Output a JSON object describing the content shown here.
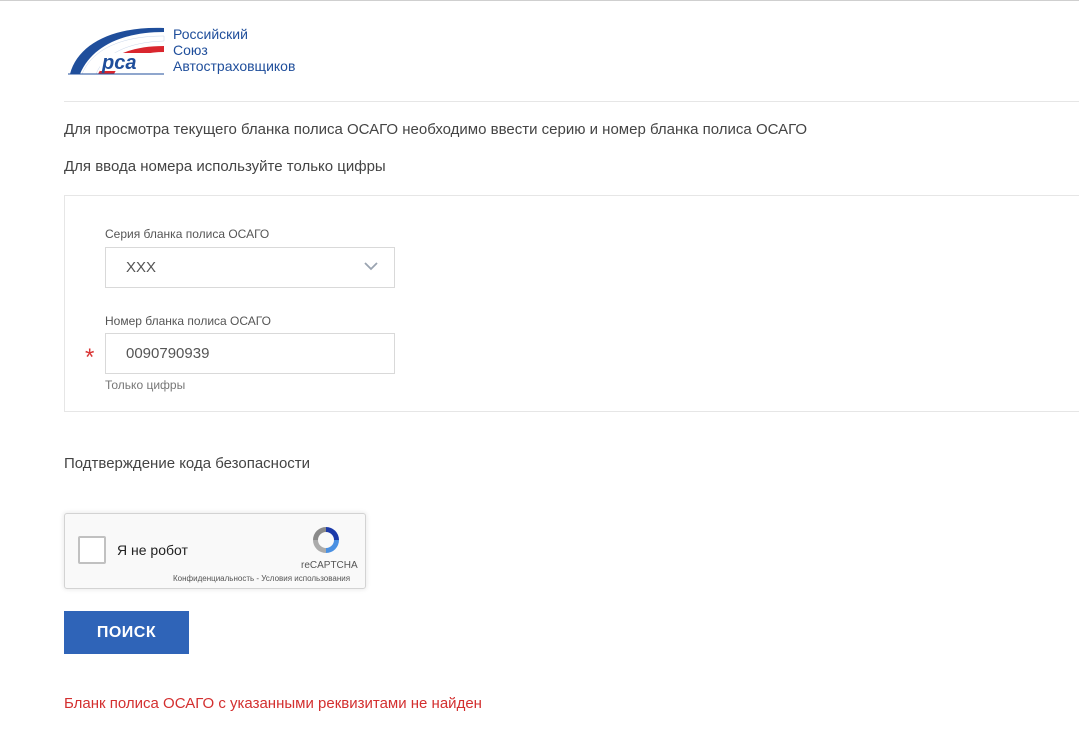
{
  "header": {
    "logo_mark": "рса",
    "org_name_lines": [
      "Российский",
      "Союз",
      "Автостраховщиков"
    ]
  },
  "intro": {
    "line1": "Для просмотра текущего бланка полиса ОСАГО необходимо ввести серию и номер бланка полиса ОСАГО",
    "line2": "Для ввода номера используйте только цифры"
  },
  "form": {
    "series_label": "Серия бланка полиса ОСАГО",
    "series_value": "XXX",
    "number_label": "Номер бланка полиса ОСАГО",
    "number_value": "0090790939",
    "required_mark": "*",
    "number_hint": "Только цифры"
  },
  "captcha": {
    "title": "Подтверждение кода безопасности",
    "checkbox_label": "Я не робот",
    "brand": "reCAPTCHA",
    "links": "Конфиденциальность - Условия использования"
  },
  "search_button_label": "ПОИСК",
  "error_message": "Бланк полиса ОСАГО с указанными реквизитами не найден",
  "colors": {
    "brand_blue": "#1f4e9b",
    "brand_red": "#d9262e",
    "button": "#2f64b8",
    "error": "#d32f2f"
  }
}
